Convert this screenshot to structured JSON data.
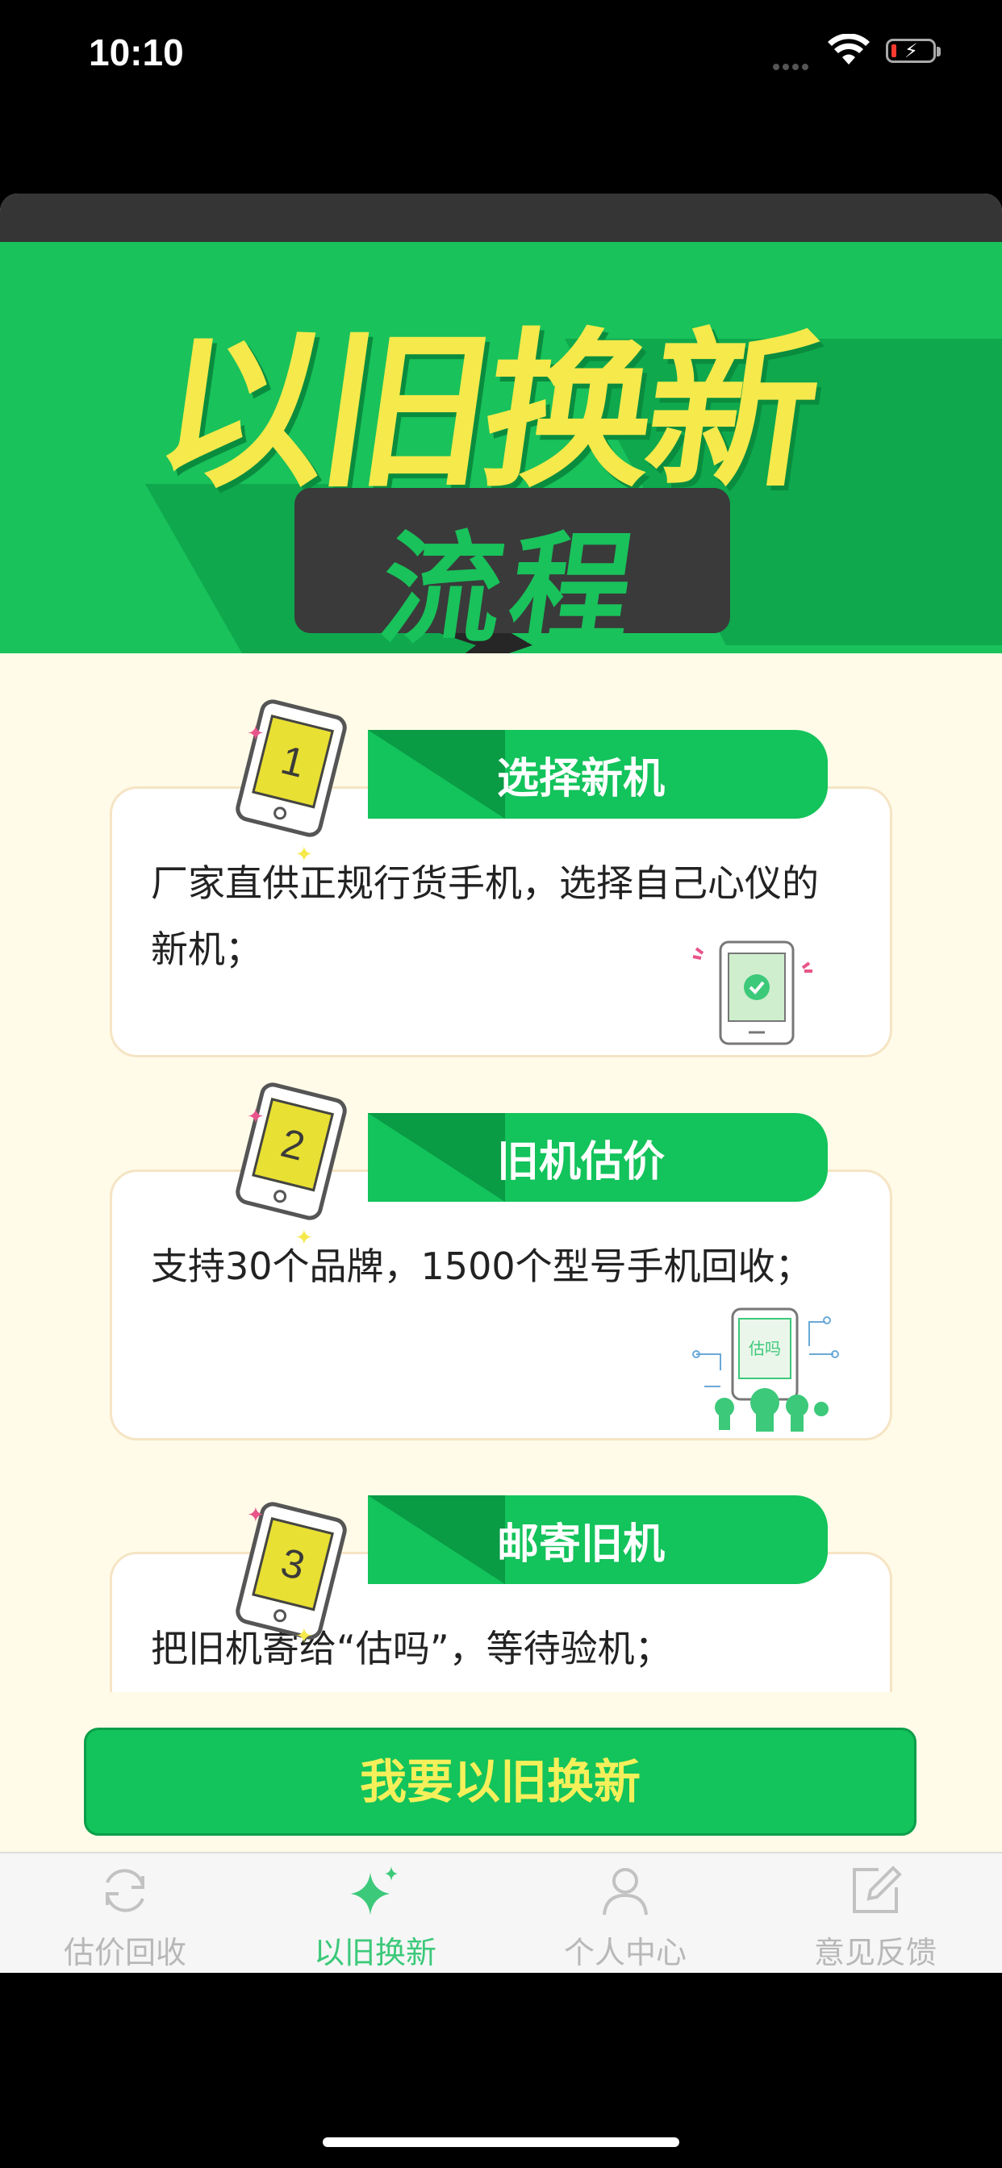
{
  "status": {
    "time": "10:10"
  },
  "banner": {
    "title": "以旧换新",
    "subtitle": "流程"
  },
  "steps": [
    {
      "number": "1",
      "title": "选择新机",
      "text": "厂家直供正规行货手机，选择自己心仪的新机；"
    },
    {
      "number": "2",
      "title": "旧机估价",
      "text": "支持30个品牌，1500个型号手机回收；"
    },
    {
      "number": "3",
      "title": "邮寄旧机",
      "text": "把旧机寄给“估吗”，等待验机；"
    }
  ],
  "step2_icon_text": "估吗",
  "cta": {
    "label": "我要以旧换新"
  },
  "tabs": [
    {
      "label": "估价回收",
      "icon": "refresh-icon"
    },
    {
      "label": "以旧换新",
      "icon": "sparkle-icon",
      "active": true
    },
    {
      "label": "个人中心",
      "icon": "user-icon"
    },
    {
      "label": "意见反馈",
      "icon": "edit-icon"
    }
  ],
  "colors": {
    "primary_green": "#13c35b",
    "accent_yellow": "#f5e94b",
    "background": "#fffbe8"
  }
}
